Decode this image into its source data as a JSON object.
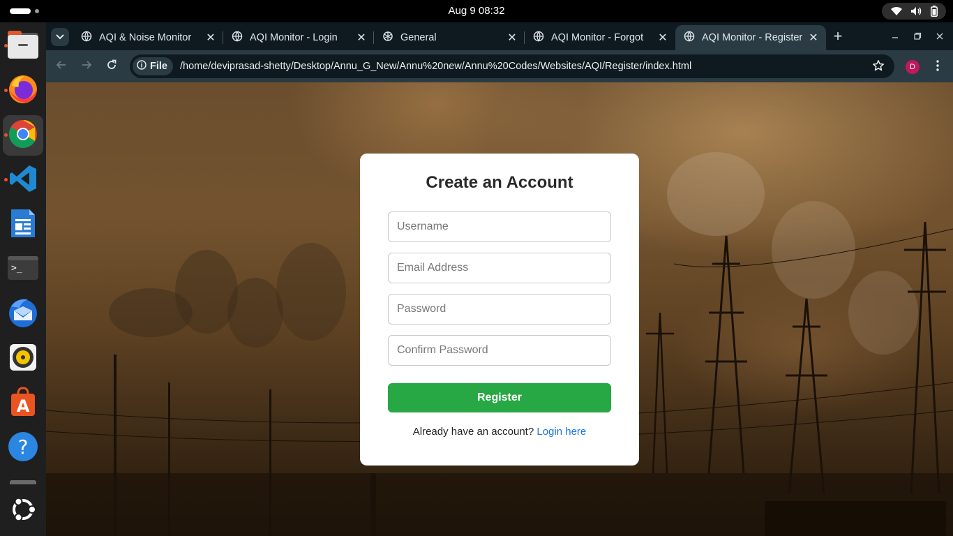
{
  "system": {
    "clock": "Aug 9  08:32",
    "tray_icons": [
      "wifi-icon",
      "volume-icon",
      "battery-icon"
    ]
  },
  "dock": {
    "items": [
      {
        "name": "Files",
        "icon": "files-icon",
        "running": true
      },
      {
        "name": "Firefox",
        "icon": "firefox-icon",
        "running": true
      },
      {
        "name": "Google Chrome",
        "icon": "chrome-icon",
        "running": true,
        "active": true
      },
      {
        "name": "Visual Studio Code",
        "icon": "vscode-icon",
        "running": true
      },
      {
        "name": "LibreOffice Writer",
        "icon": "writer-icon",
        "running": false
      },
      {
        "name": "Terminal",
        "icon": "terminal-icon",
        "running": false
      },
      {
        "name": "Thunderbird",
        "icon": "thunderbird-icon",
        "running": false
      },
      {
        "name": "Rhythmbox",
        "icon": "rhythmbox-icon",
        "running": false
      },
      {
        "name": "App Center",
        "icon": "app-center-icon",
        "running": false
      },
      {
        "name": "Help",
        "icon": "help-icon",
        "running": false
      },
      {
        "name": "Show Apps",
        "icon": "ubuntu-icon",
        "running": false
      }
    ]
  },
  "browser": {
    "tabs": [
      {
        "title": "AQI & Noise Monitor",
        "icon": "globe-icon"
      },
      {
        "title": "AQI Monitor - Login",
        "icon": "globe-icon"
      },
      {
        "title": "General",
        "icon": "openai-icon"
      },
      {
        "title": "AQI Monitor - Forgot",
        "icon": "globe-icon"
      },
      {
        "title": "AQI Monitor - Register",
        "icon": "globe-icon",
        "active": true
      }
    ],
    "omnibox": {
      "scheme_label": "File",
      "url": "/home/deviprasad-shetty/Desktop/Annu_G_New/Annu%20new/Annu%20Codes/Websites/AQI/Register/index.html"
    },
    "profile_initial": "D"
  },
  "page": {
    "title": "Create an Account",
    "fields": {
      "username_placeholder": "Username",
      "email_placeholder": "Email Address",
      "password_placeholder": "Password",
      "confirm_placeholder": "Confirm Password"
    },
    "register_label": "Register",
    "login_prompt": "Already have an account?",
    "login_link": "Login here"
  },
  "colors": {
    "primary_button": "#28a745",
    "link": "#1a73e8",
    "chrome_tabstrip": "#0f1a20",
    "chrome_toolbar": "#2b3b44"
  }
}
